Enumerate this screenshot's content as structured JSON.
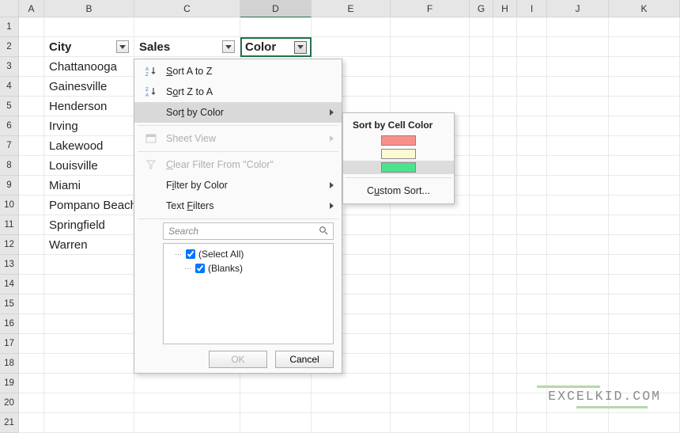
{
  "columns": [
    "A",
    "B",
    "C",
    "D",
    "E",
    "F",
    "G",
    "H",
    "I",
    "J",
    "K"
  ],
  "rows_count": 21,
  "selected_cell": {
    "col": "D",
    "row": 2
  },
  "headers": {
    "B": "City",
    "C": "Sales",
    "D": "Color"
  },
  "data_cells": {
    "B3": "Chattanooga",
    "B4": "Gainesville",
    "B5": "Henderson",
    "B6": "Irving",
    "B7": "Lakewood",
    "B8": "Louisville",
    "B9": "Miami",
    "B10": "Pompano Beach",
    "B11": "Springfield",
    "B12": "Warren"
  },
  "menu": {
    "sort_az": "Sort A to Z",
    "sort_za": "Sort Z to A",
    "sort_by_color": "Sort by Color",
    "sheet_view": "Sheet View",
    "clear_filter": "Clear Filter From \"Color\"",
    "filter_by_color": "Filter by Color",
    "text_filters": "Text Filters",
    "search_placeholder": "Search",
    "select_all": "(Select All)",
    "blanks": "(Blanks)",
    "ok": "OK",
    "cancel": "Cancel"
  },
  "submenu": {
    "title": "Sort by Cell Color",
    "colors": [
      "#f98f8b",
      "#fdf9d2",
      "#4be38e"
    ],
    "custom": "Custom Sort..."
  },
  "watermark": "EXCELKID.COM"
}
